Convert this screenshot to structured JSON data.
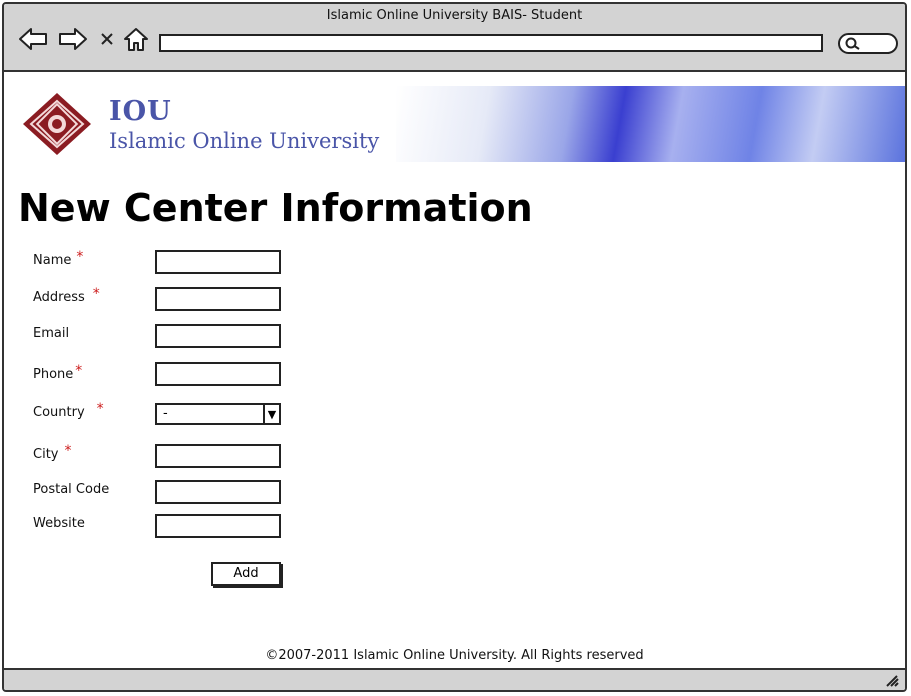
{
  "window": {
    "title": "Islamic Online University BAIS- Student"
  },
  "icons": {
    "back": "back-arrow-icon",
    "forward": "forward-arrow-icon",
    "stop": "close-icon",
    "home": "home-icon",
    "search": "search-icon",
    "resize": "resize-grip-icon"
  },
  "banner": {
    "abbr": "IOU",
    "name": "Islamic Online University",
    "accent_color": "#4a55a8"
  },
  "form": {
    "title": "New Center Information",
    "required_marker": "*",
    "required_color": "#cc1b1b",
    "fields": [
      {
        "label": "Name",
        "required": true,
        "value": ""
      },
      {
        "label": "Address",
        "required": true,
        "value": ""
      },
      {
        "label": "Email",
        "required": false,
        "value": ""
      },
      {
        "label": "Phone",
        "required": true,
        "value": ""
      },
      {
        "label": "Country",
        "required": true,
        "value": "-"
      },
      {
        "label": "City",
        "required": true,
        "value": ""
      },
      {
        "label": "Postal Code",
        "required": false,
        "value": ""
      },
      {
        "label": "Website",
        "required": false,
        "value": ""
      }
    ],
    "add_label": "Add"
  },
  "footer": {
    "text": "©2007-2011 Islamic Online University. All Rights reserved"
  }
}
